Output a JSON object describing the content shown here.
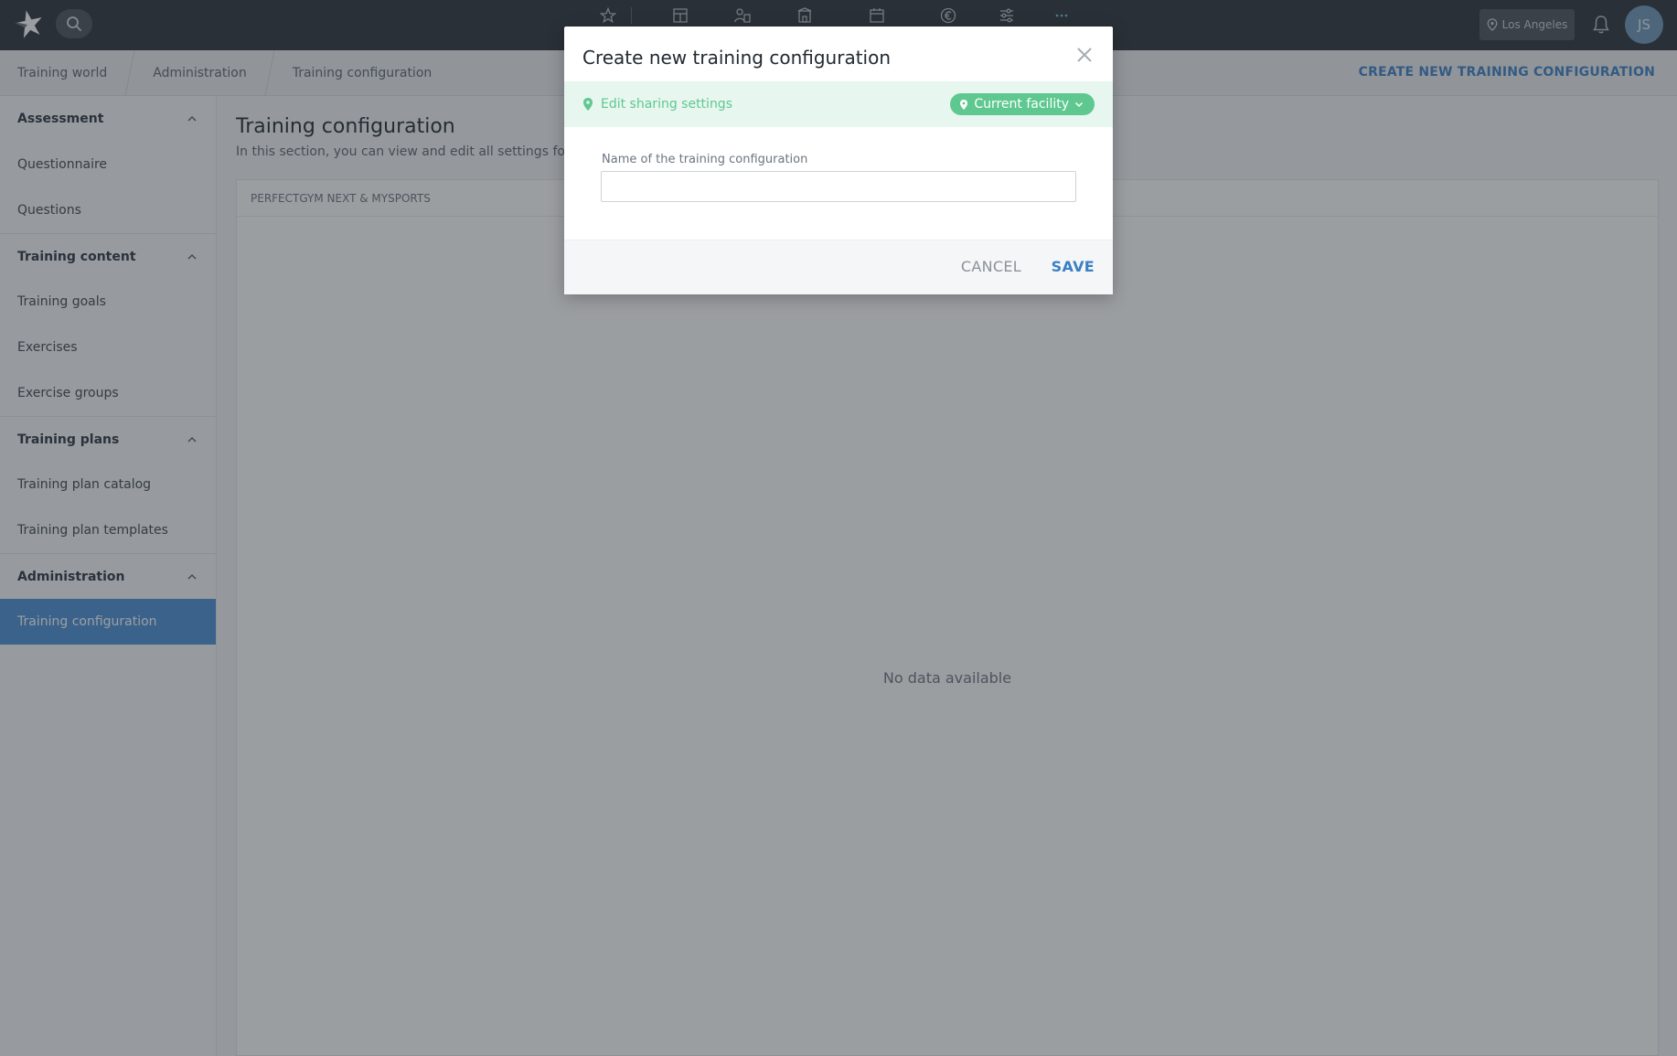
{
  "topbar": {
    "logo_icon": "star-logo-icon",
    "search_icon": "search-icon",
    "nav_icons": [
      "star-icon",
      "dashboard-icon",
      "members-icon",
      "facility-icon",
      "calendar-icon",
      "euro-icon",
      "sliders-icon",
      "more-icon"
    ],
    "location_label": "Los Angeles",
    "avatar_initials": "JS"
  },
  "breadcrumb": {
    "items": [
      "Training world",
      "Administration",
      "Training configuration"
    ],
    "action_label": "CREATE NEW TRAINING CONFIGURATION"
  },
  "sidebar": {
    "sections": [
      {
        "title": "Assessment",
        "items": [
          "Questionnaire",
          "Questions"
        ]
      },
      {
        "title": "Training content",
        "items": [
          "Training goals",
          "Exercises",
          "Exercise groups"
        ]
      },
      {
        "title": "Training plans",
        "items": [
          "Training plan catalog",
          "Training plan templates"
        ]
      },
      {
        "title": "Administration",
        "items": [
          "Training configuration"
        ]
      }
    ],
    "active_item": "Training configuration"
  },
  "main": {
    "title": "Training configuration",
    "description": "In this section, you can view and edit all settings for you",
    "panel_header": "PERFECTGYM NEXT & MYSPORTS",
    "empty_text": "No data available"
  },
  "modal": {
    "title": "Create new training configuration",
    "sharing_label": "Edit sharing settings",
    "facility_label": "Current facility",
    "field_label": "Name of the training configuration",
    "field_value": "",
    "field_placeholder": "",
    "cancel_label": "CANCEL",
    "save_label": "SAVE"
  },
  "colors": {
    "topbar": "#2b3037",
    "accent_blue": "#3b7fc4",
    "active_item": "#4a8fd6",
    "share_green": "#5fc890"
  }
}
